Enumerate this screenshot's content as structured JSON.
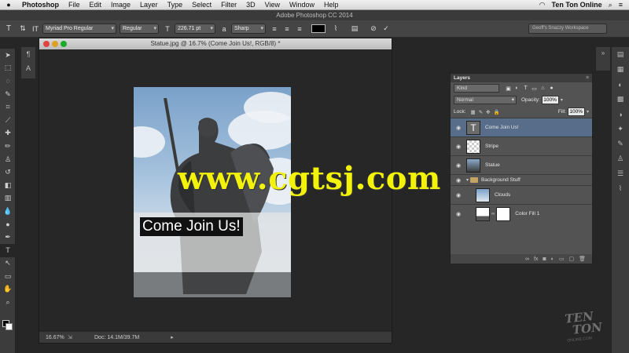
{
  "menubar": {
    "apple": "",
    "items": [
      "Photoshop",
      "File",
      "Edit",
      "Image",
      "Layer",
      "Type",
      "Select",
      "Filter",
      "3D",
      "View",
      "Window",
      "Help"
    ],
    "user": "Ten Ton Online"
  },
  "app_title": "Adobe Photoshop CC 2014",
  "options": {
    "font_family": "Myriad Pro Regular",
    "font_style": "Regular",
    "font_size": "226.71 pt",
    "antialias": "Sharp",
    "text_color": "#000000",
    "workspace": "Geoff's Snazzy Workspace"
  },
  "document": {
    "title": "Statue.jpg @ 16.7% (Come Join Us!, RGB/8) *",
    "zoom": "16.67%",
    "doc_size": "Doc: 14.1M/39.7M",
    "headline": "Come Join Us!"
  },
  "watermark": "www.cgtsj.com",
  "layers_panel": {
    "title": "Layers",
    "kind": "Kind",
    "blend_mode": "Normal",
    "opacity_label": "Opacity:",
    "opacity": "100%",
    "lock_label": "Lock:",
    "fill_label": "Fill:",
    "fill": "100%",
    "layers": [
      {
        "name": "Come Join Us!",
        "type": "text",
        "selected": true
      },
      {
        "name": "Stripe",
        "type": "pixel",
        "selected": false
      },
      {
        "name": "Statue",
        "type": "pixel",
        "selected": false
      }
    ],
    "group": {
      "name": "Background Stuff",
      "children": [
        {
          "name": "Clouds",
          "type": "pixel"
        },
        {
          "name": "Color Fill 1",
          "type": "fill"
        }
      ]
    }
  },
  "logo": {
    "line1": "TEN",
    "line2": "TON",
    "line3": "ONLINE.COM"
  },
  "colors": {
    "selection": "#586d8a",
    "panel": "#535353",
    "watermark": "#f2f20a"
  }
}
